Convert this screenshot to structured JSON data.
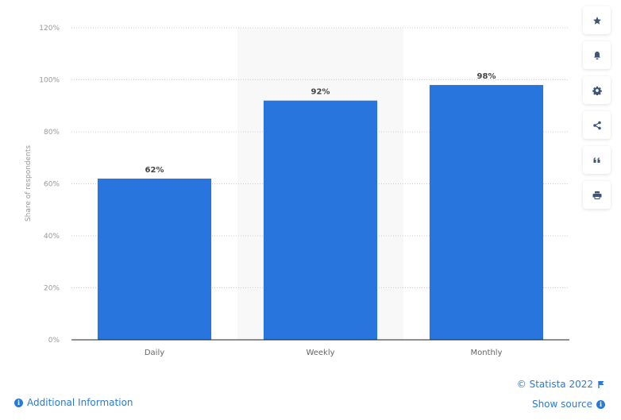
{
  "chart_data": {
    "type": "bar",
    "title": "",
    "xlabel": "",
    "ylabel": "Share of respondents",
    "categories": [
      "Daily",
      "Weekly",
      "Monthly"
    ],
    "values": [
      62,
      92,
      98
    ],
    "value_labels": [
      "62%",
      "92%",
      "98%"
    ],
    "ylim": [
      0,
      120
    ],
    "yticks": [
      0,
      20,
      40,
      60,
      80,
      100,
      120
    ],
    "ytick_labels": [
      "0%",
      "20%",
      "40%",
      "60%",
      "80%",
      "100%",
      "120%"
    ],
    "grid": true,
    "highlighted_category": "Weekly",
    "bar_color": "#2876dd"
  },
  "toolbar": [
    {
      "name": "favorite",
      "icon": "star-icon"
    },
    {
      "name": "notification",
      "icon": "bell-icon"
    },
    {
      "name": "settings",
      "icon": "gear-icon"
    },
    {
      "name": "share",
      "icon": "share-icon"
    },
    {
      "name": "cite",
      "icon": "quote-icon"
    },
    {
      "name": "print",
      "icon": "printer-icon"
    }
  ],
  "footer": {
    "additional_info": "Additional Information",
    "copyright": "© Statista 2022",
    "show_source": "Show source"
  }
}
